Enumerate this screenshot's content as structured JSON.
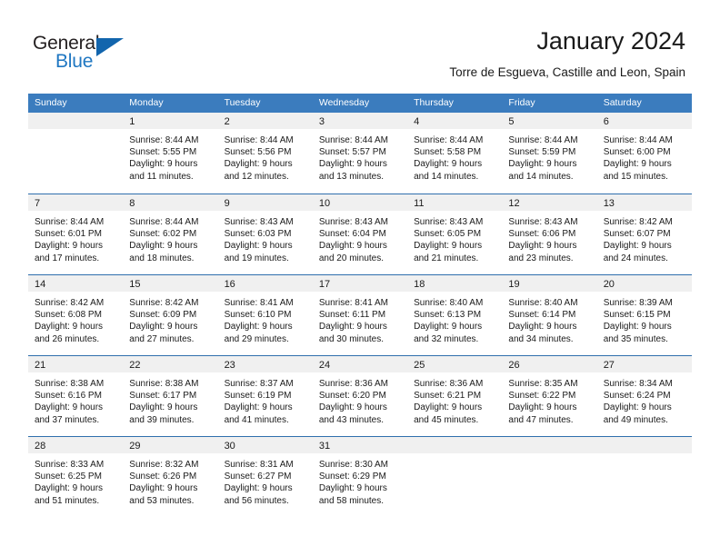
{
  "brand": {
    "name_part1": "General",
    "name_part2": "Blue",
    "accent_color": "#1265ad"
  },
  "header": {
    "title": "January 2024",
    "location": "Torre de Esgueva, Castille and Leon, Spain"
  },
  "calendar": {
    "header_color": "#3b7cbe",
    "weekdays": [
      "Sunday",
      "Monday",
      "Tuesday",
      "Wednesday",
      "Thursday",
      "Friday",
      "Saturday"
    ],
    "weeks": [
      [
        {
          "day": "",
          "lines": []
        },
        {
          "day": "1",
          "lines": [
            "Sunrise: 8:44 AM",
            "Sunset: 5:55 PM",
            "Daylight: 9 hours",
            "and 11 minutes."
          ]
        },
        {
          "day": "2",
          "lines": [
            "Sunrise: 8:44 AM",
            "Sunset: 5:56 PM",
            "Daylight: 9 hours",
            "and 12 minutes."
          ]
        },
        {
          "day": "3",
          "lines": [
            "Sunrise: 8:44 AM",
            "Sunset: 5:57 PM",
            "Daylight: 9 hours",
            "and 13 minutes."
          ]
        },
        {
          "day": "4",
          "lines": [
            "Sunrise: 8:44 AM",
            "Sunset: 5:58 PM",
            "Daylight: 9 hours",
            "and 14 minutes."
          ]
        },
        {
          "day": "5",
          "lines": [
            "Sunrise: 8:44 AM",
            "Sunset: 5:59 PM",
            "Daylight: 9 hours",
            "and 14 minutes."
          ]
        },
        {
          "day": "6",
          "lines": [
            "Sunrise: 8:44 AM",
            "Sunset: 6:00 PM",
            "Daylight: 9 hours",
            "and 15 minutes."
          ]
        }
      ],
      [
        {
          "day": "7",
          "lines": [
            "Sunrise: 8:44 AM",
            "Sunset: 6:01 PM",
            "Daylight: 9 hours",
            "and 17 minutes."
          ]
        },
        {
          "day": "8",
          "lines": [
            "Sunrise: 8:44 AM",
            "Sunset: 6:02 PM",
            "Daylight: 9 hours",
            "and 18 minutes."
          ]
        },
        {
          "day": "9",
          "lines": [
            "Sunrise: 8:43 AM",
            "Sunset: 6:03 PM",
            "Daylight: 9 hours",
            "and 19 minutes."
          ]
        },
        {
          "day": "10",
          "lines": [
            "Sunrise: 8:43 AM",
            "Sunset: 6:04 PM",
            "Daylight: 9 hours",
            "and 20 minutes."
          ]
        },
        {
          "day": "11",
          "lines": [
            "Sunrise: 8:43 AM",
            "Sunset: 6:05 PM",
            "Daylight: 9 hours",
            "and 21 minutes."
          ]
        },
        {
          "day": "12",
          "lines": [
            "Sunrise: 8:43 AM",
            "Sunset: 6:06 PM",
            "Daylight: 9 hours",
            "and 23 minutes."
          ]
        },
        {
          "day": "13",
          "lines": [
            "Sunrise: 8:42 AM",
            "Sunset: 6:07 PM",
            "Daylight: 9 hours",
            "and 24 minutes."
          ]
        }
      ],
      [
        {
          "day": "14",
          "lines": [
            "Sunrise: 8:42 AM",
            "Sunset: 6:08 PM",
            "Daylight: 9 hours",
            "and 26 minutes."
          ]
        },
        {
          "day": "15",
          "lines": [
            "Sunrise: 8:42 AM",
            "Sunset: 6:09 PM",
            "Daylight: 9 hours",
            "and 27 minutes."
          ]
        },
        {
          "day": "16",
          "lines": [
            "Sunrise: 8:41 AM",
            "Sunset: 6:10 PM",
            "Daylight: 9 hours",
            "and 29 minutes."
          ]
        },
        {
          "day": "17",
          "lines": [
            "Sunrise: 8:41 AM",
            "Sunset: 6:11 PM",
            "Daylight: 9 hours",
            "and 30 minutes."
          ]
        },
        {
          "day": "18",
          "lines": [
            "Sunrise: 8:40 AM",
            "Sunset: 6:13 PM",
            "Daylight: 9 hours",
            "and 32 minutes."
          ]
        },
        {
          "day": "19",
          "lines": [
            "Sunrise: 8:40 AM",
            "Sunset: 6:14 PM",
            "Daylight: 9 hours",
            "and 34 minutes."
          ]
        },
        {
          "day": "20",
          "lines": [
            "Sunrise: 8:39 AM",
            "Sunset: 6:15 PM",
            "Daylight: 9 hours",
            "and 35 minutes."
          ]
        }
      ],
      [
        {
          "day": "21",
          "lines": [
            "Sunrise: 8:38 AM",
            "Sunset: 6:16 PM",
            "Daylight: 9 hours",
            "and 37 minutes."
          ]
        },
        {
          "day": "22",
          "lines": [
            "Sunrise: 8:38 AM",
            "Sunset: 6:17 PM",
            "Daylight: 9 hours",
            "and 39 minutes."
          ]
        },
        {
          "day": "23",
          "lines": [
            "Sunrise: 8:37 AM",
            "Sunset: 6:19 PM",
            "Daylight: 9 hours",
            "and 41 minutes."
          ]
        },
        {
          "day": "24",
          "lines": [
            "Sunrise: 8:36 AM",
            "Sunset: 6:20 PM",
            "Daylight: 9 hours",
            "and 43 minutes."
          ]
        },
        {
          "day": "25",
          "lines": [
            "Sunrise: 8:36 AM",
            "Sunset: 6:21 PM",
            "Daylight: 9 hours",
            "and 45 minutes."
          ]
        },
        {
          "day": "26",
          "lines": [
            "Sunrise: 8:35 AM",
            "Sunset: 6:22 PM",
            "Daylight: 9 hours",
            "and 47 minutes."
          ]
        },
        {
          "day": "27",
          "lines": [
            "Sunrise: 8:34 AM",
            "Sunset: 6:24 PM",
            "Daylight: 9 hours",
            "and 49 minutes."
          ]
        }
      ],
      [
        {
          "day": "28",
          "lines": [
            "Sunrise: 8:33 AM",
            "Sunset: 6:25 PM",
            "Daylight: 9 hours",
            "and 51 minutes."
          ]
        },
        {
          "day": "29",
          "lines": [
            "Sunrise: 8:32 AM",
            "Sunset: 6:26 PM",
            "Daylight: 9 hours",
            "and 53 minutes."
          ]
        },
        {
          "day": "30",
          "lines": [
            "Sunrise: 8:31 AM",
            "Sunset: 6:27 PM",
            "Daylight: 9 hours",
            "and 56 minutes."
          ]
        },
        {
          "day": "31",
          "lines": [
            "Sunrise: 8:30 AM",
            "Sunset: 6:29 PM",
            "Daylight: 9 hours",
            "and 58 minutes."
          ]
        },
        {
          "day": "",
          "lines": []
        },
        {
          "day": "",
          "lines": []
        },
        {
          "day": "",
          "lines": []
        }
      ]
    ]
  }
}
